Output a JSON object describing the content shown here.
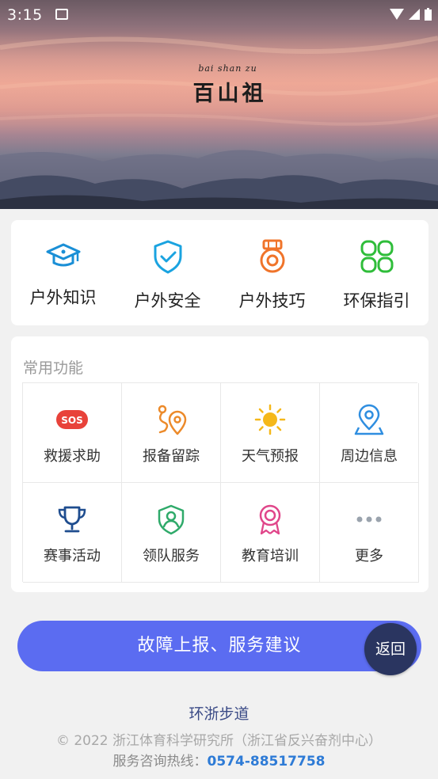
{
  "status_bar": {
    "time": "3:15"
  },
  "hero": {
    "pinyin": "bai shan zu",
    "title": "百山祖"
  },
  "top_nav": [
    {
      "label": "户外知识",
      "icon": "graduation-cap-icon",
      "color": "#1a8fd6"
    },
    {
      "label": "户外安全",
      "icon": "shield-check-icon",
      "color": "#1aa3e0"
    },
    {
      "label": "户外技巧",
      "icon": "medal-icon",
      "color": "#f0742a"
    },
    {
      "label": "环保指引",
      "icon": "eco-circles-icon",
      "color": "#2fbd3a"
    }
  ],
  "common": {
    "title": "常用功能",
    "items": [
      {
        "label": "救援求助",
        "icon": "sos-icon",
        "color": "#e8423a"
      },
      {
        "label": "报备留踪",
        "icon": "route-pin-icon",
        "color": "#ec8a2a"
      },
      {
        "label": "天气预报",
        "icon": "sun-icon",
        "color": "#f5b81a"
      },
      {
        "label": "周边信息",
        "icon": "map-pin-icon",
        "color": "#2f8ee0"
      },
      {
        "label": "赛事活动",
        "icon": "trophy-icon",
        "color": "#1f4d8f"
      },
      {
        "label": "领队服务",
        "icon": "leader-badge-icon",
        "color": "#2faa6a"
      },
      {
        "label": "教育培训",
        "icon": "ribbon-medal-icon",
        "color": "#e0468a"
      },
      {
        "label": "更多",
        "icon": "more-dots-icon",
        "color": "#9aa3ad"
      }
    ]
  },
  "report_button": "故障上报、服务建议",
  "back_button": "返回",
  "footer": {
    "name": "环浙步道",
    "copyright": "© 2022 浙江体育科学研究所（浙江省反兴奋剂中心）",
    "hotline_label": "服务咨询热线：",
    "hotline_number": "0574-88517758"
  }
}
